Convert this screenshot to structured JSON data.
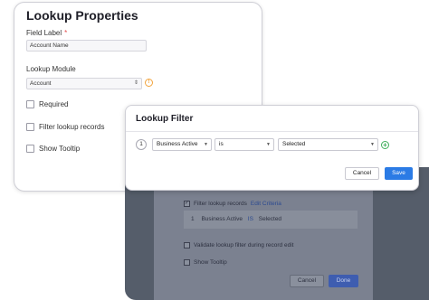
{
  "properties": {
    "title": "Lookup Properties",
    "field_label": "Field Label",
    "required_mark": "*",
    "field_value": "Account Name",
    "module_label": "Lookup Module",
    "module_value": "Account",
    "info_icon": "!",
    "checkboxes": [
      {
        "label": "Required",
        "checked": false
      },
      {
        "label": "Filter lookup records",
        "checked": false
      },
      {
        "label": "Show Tooltip",
        "checked": false
      }
    ]
  },
  "background_modal": {
    "filter_label": "Filter lookup records",
    "edit_link": "Edit Criteria",
    "criteria": {
      "index": "1",
      "field": "Business Active",
      "operator": "IS",
      "value": "Selected"
    },
    "validate_label": "Validate lookup filter during record edit",
    "tooltip_label": "Show Tooltip",
    "cancel_label": "Cancel",
    "done_label": "Done"
  },
  "lookup_filter": {
    "title": "Lookup Filter",
    "row_index": "1",
    "field": "Business Active",
    "operator": "is",
    "value": "Selected",
    "cancel_label": "Cancel",
    "save_label": "Save"
  },
  "colors": {
    "save_button": "#2b7be5",
    "add_icon": "#3fae5b",
    "info_icon": "#f2a33c",
    "required_star": "#e24c4c"
  }
}
